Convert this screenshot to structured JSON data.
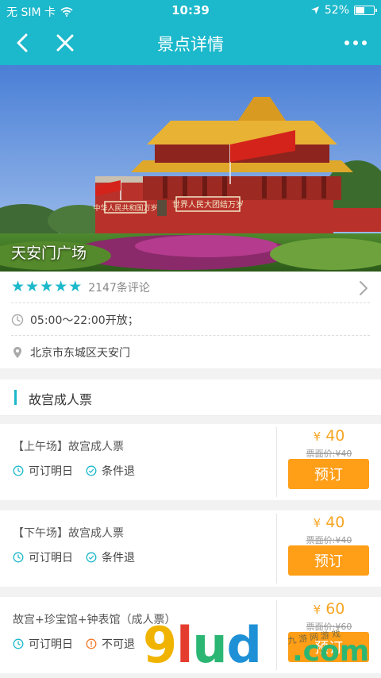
{
  "status_bar": {
    "carrier": "无 SIM 卡",
    "time": "10:39",
    "battery_percent": "52%",
    "battery_level": 0.52
  },
  "nav": {
    "title": "景点详情",
    "back_icon": "chevron-left-icon",
    "close_icon": "close-icon",
    "more_icon": "more-dots-icon"
  },
  "hero": {
    "name": "天安门广场",
    "sign_left": "中华人民共和国万岁",
    "sign_right": "世界人民大团结万岁"
  },
  "info": {
    "rating_stars": 5,
    "reviews": "2147条评论",
    "hours": "05:00～22:00开放；",
    "address": "北京市东城区天安门"
  },
  "section": {
    "title": "故宫成人票"
  },
  "tickets": [
    {
      "name": "【上午场】故宫成人票",
      "feature1": "可订明日",
      "feature2": "条件退",
      "currency": "¥",
      "price": "40",
      "face_value": "票面价:¥40",
      "book_label": "预订"
    },
    {
      "name": "【下午场】故宫成人票",
      "feature1": "可订明日",
      "feature2": "条件退",
      "currency": "¥",
      "price": "40",
      "face_value": "票面价:¥40",
      "book_label": "预订"
    },
    {
      "name": "故宫+珍宝馆+钟表馆（成人票）",
      "feature1": "可订明日",
      "feature2": "不可退",
      "currency": "¥",
      "price": "60",
      "face_value": "票面价:¥60",
      "book_label": "预订"
    }
  ],
  "watermark": {
    "main": "9lud",
    "suffix": ".com",
    "chinese": "九游网游戏"
  },
  "colors": {
    "brand": "#1cb8cb",
    "price": "#f5a623",
    "book_button": "#ff9e17"
  }
}
